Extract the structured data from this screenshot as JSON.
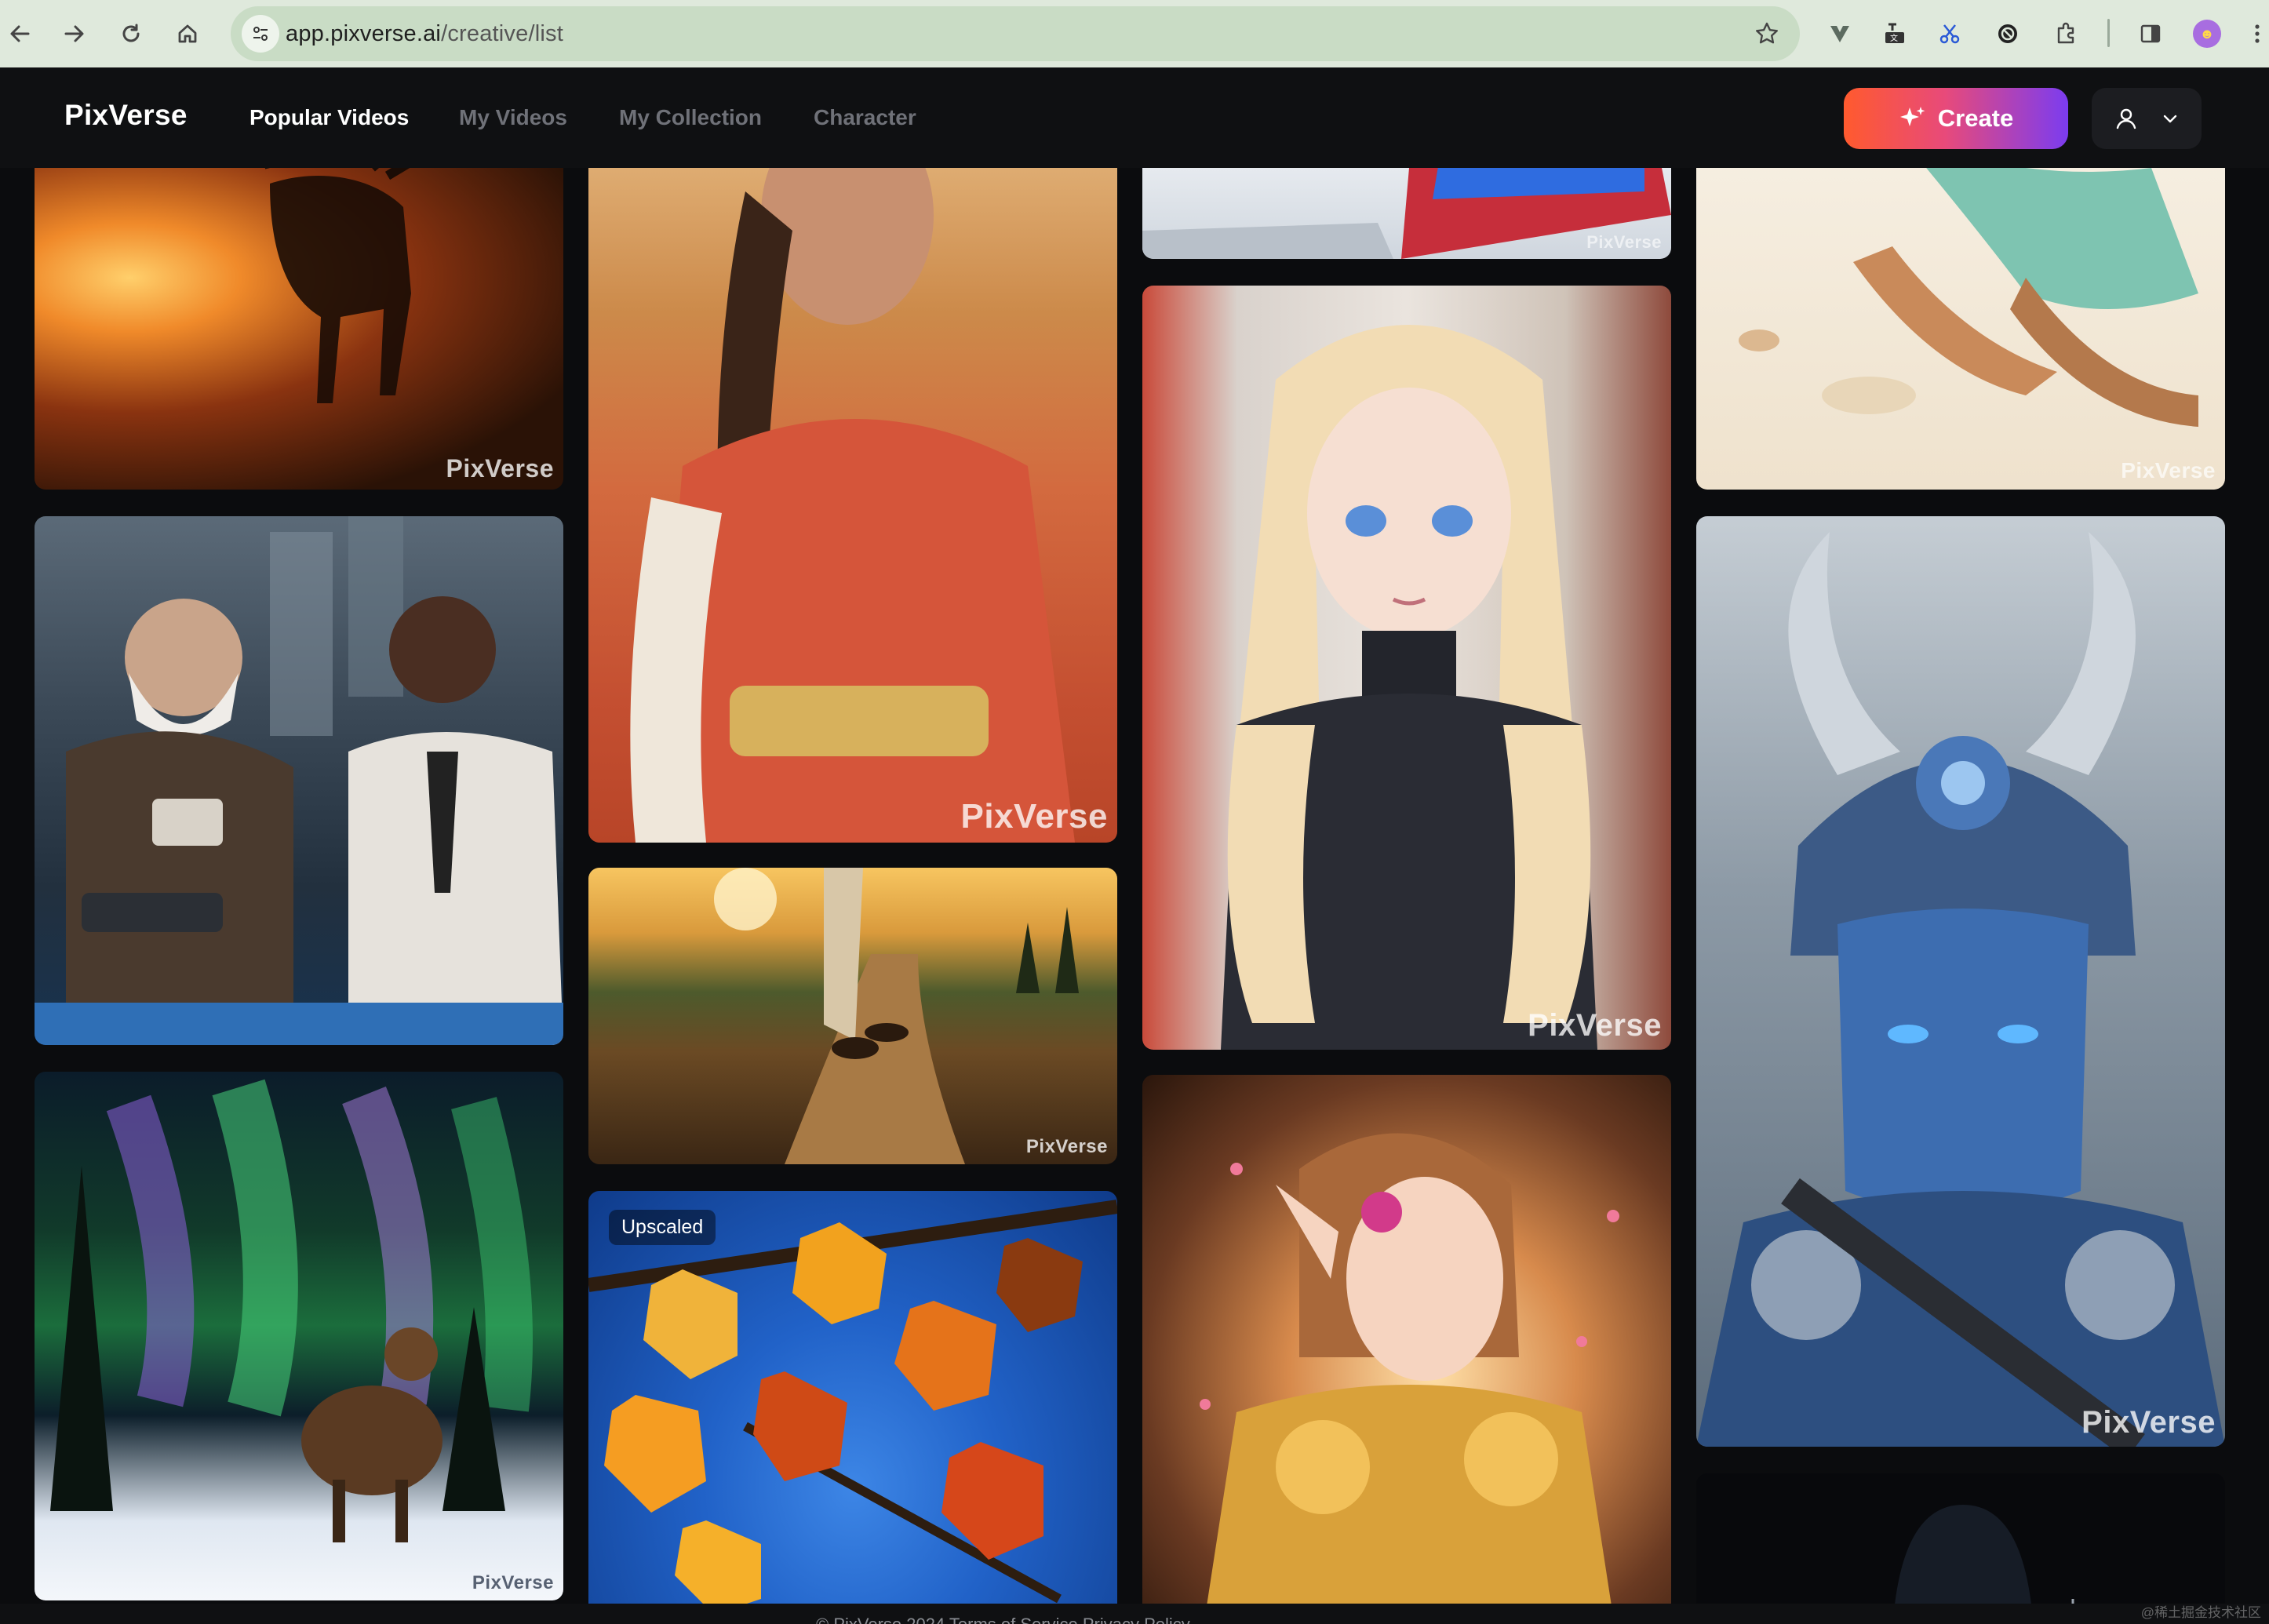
{
  "browser": {
    "url_host": "app.pixverse.ai",
    "url_path": "/creative/list"
  },
  "header": {
    "logo": "PixVerse",
    "tabs": [
      {
        "label": "Popular Videos",
        "active": true
      },
      {
        "label": "My Videos",
        "active": false
      },
      {
        "label": "My Collection",
        "active": false
      },
      {
        "label": "Character",
        "active": false
      }
    ],
    "create_label": "Create"
  },
  "gallery": {
    "watermark": "PixVerse",
    "cards": [
      {
        "name": "card-fire-moose",
        "subject": "moose-in-fire",
        "palette": [
          "#2a1206",
          "#c4561a",
          "#ffb35a"
        ]
      },
      {
        "name": "card-police-car",
        "subject": "two-officers-in-car",
        "palette": [
          "#2d3a48",
          "#6b7f93",
          "#1a2b3f"
        ]
      },
      {
        "name": "card-aurora-sheep",
        "subject": "sheep-under-aurora",
        "palette": [
          "#0c1a2a",
          "#3fbf6a",
          "#8a5fd0"
        ]
      },
      {
        "name": "card-woman-red-dress",
        "subject": "woman-in-red-dress",
        "palette": [
          "#c95c3a",
          "#e07a4a",
          "#6b4a2a"
        ]
      },
      {
        "name": "card-walking-path",
        "subject": "feet-walking-on-path",
        "palette": [
          "#3b2a14",
          "#b98a3c",
          "#f1c26b"
        ]
      },
      {
        "name": "card-autumn-leaves",
        "subject": "autumn-leaves",
        "palette": [
          "#2d6fd6",
          "#f59a1c",
          "#d6471a"
        ],
        "badge": "Upscaled"
      },
      {
        "name": "card-toy-car",
        "subject": "toy-car-detail",
        "palette": [
          "#dfe4ea",
          "#c62e3b",
          "#3b74e0"
        ]
      },
      {
        "name": "card-anime-blonde",
        "subject": "anime-blonde-girl",
        "palette": [
          "#f3dcb1",
          "#2a2c34",
          "#d9c6b3"
        ]
      },
      {
        "name": "card-elf-armor",
        "subject": "elf-in-golden-armor",
        "palette": [
          "#3a2214",
          "#e6a04a",
          "#f2c9a6"
        ]
      },
      {
        "name": "card-beach-girl",
        "subject": "girl-on-beach-sketch",
        "palette": [
          "#f4ead8",
          "#7ec4b1",
          "#c98a5a"
        ]
      },
      {
        "name": "card-blue-warrior",
        "subject": "blue-horned-warrior",
        "palette": [
          "#2a4a73",
          "#6d8fb3",
          "#c9d4de"
        ]
      },
      {
        "name": "card-dark-figure",
        "subject": "dark-hooded-figure",
        "palette": [
          "#050608",
          "#12161c",
          "#1e2530"
        ]
      }
    ]
  },
  "footer": {
    "text": "© PixVerse 2024   Terms of Service   Privacy Policy",
    "corner": "@稀土掘金技术社区"
  }
}
